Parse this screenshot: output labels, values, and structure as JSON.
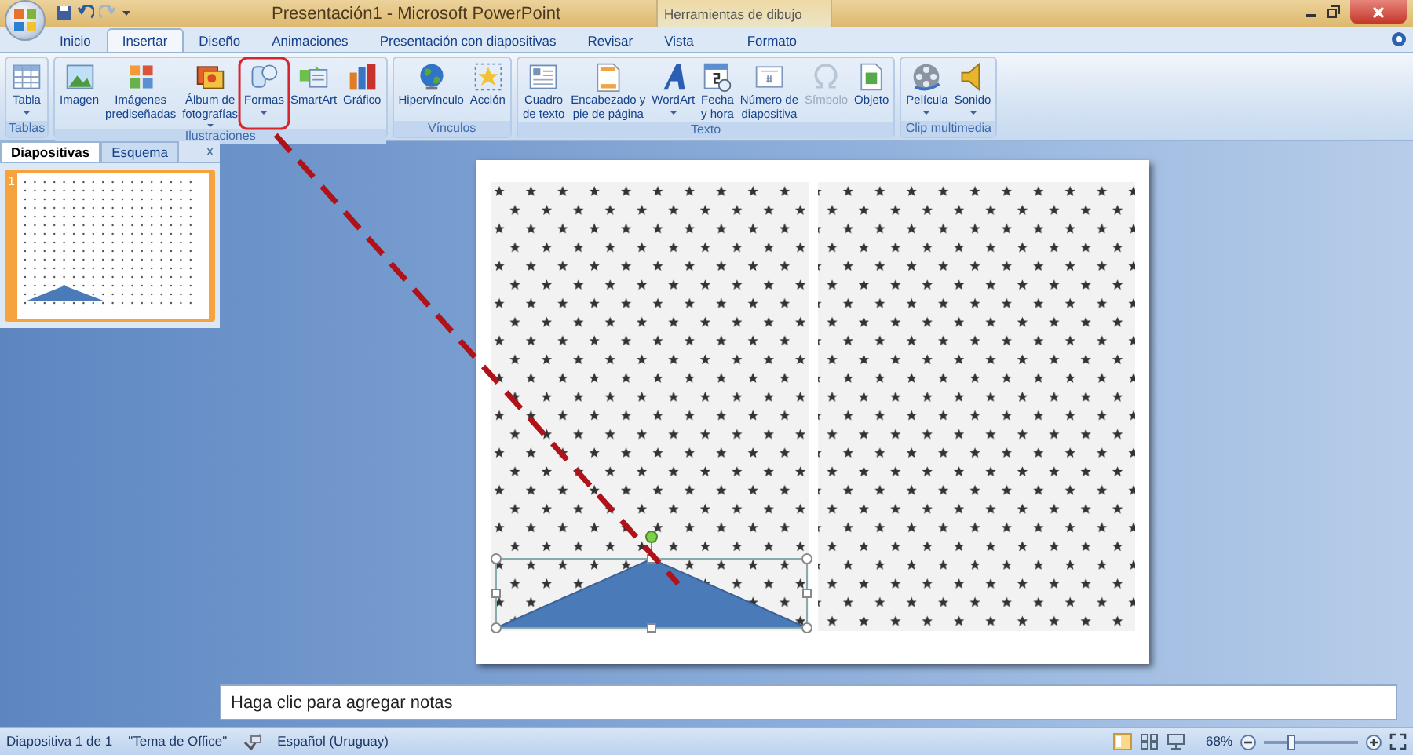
{
  "window": {
    "title": "Presentación1 - Microsoft PowerPoint",
    "contextual_tab_group": "Herramientas de dibujo"
  },
  "tabs": [
    {
      "label": "Inicio",
      "selected": false
    },
    {
      "label": "Insertar",
      "selected": true
    },
    {
      "label": "Diseño",
      "selected": false
    },
    {
      "label": "Animaciones",
      "selected": false
    },
    {
      "label": "Presentación con diapositivas",
      "selected": false
    },
    {
      "label": "Revisar",
      "selected": false
    },
    {
      "label": "Vista",
      "selected": false
    },
    {
      "label": "Formato",
      "selected": false
    }
  ],
  "ribbon_groups": [
    {
      "label": "Tablas",
      "buttons": [
        {
          "label": "Tabla",
          "dropdown": true,
          "disabled": false,
          "highlighted": false
        }
      ]
    },
    {
      "label": "Ilustraciones",
      "buttons": [
        {
          "label": "Imagen",
          "dropdown": false,
          "disabled": false,
          "highlighted": false
        },
        {
          "label": "Imágenes\nprediseñadas",
          "dropdown": false,
          "disabled": false,
          "highlighted": false
        },
        {
          "label": "Álbum de\nfotografías",
          "dropdown": true,
          "disabled": false,
          "highlighted": false
        },
        {
          "label": "Formas",
          "dropdown": true,
          "disabled": false,
          "highlighted": true
        },
        {
          "label": "SmartArt",
          "dropdown": false,
          "disabled": false,
          "highlighted": false
        },
        {
          "label": "Gráfico",
          "dropdown": false,
          "disabled": false,
          "highlighted": false
        }
      ]
    },
    {
      "label": "Vínculos",
      "buttons": [
        {
          "label": "Hipervínculo",
          "dropdown": false,
          "disabled": false,
          "highlighted": false
        },
        {
          "label": "Acción",
          "dropdown": false,
          "disabled": false,
          "highlighted": false
        }
      ]
    },
    {
      "label": "Texto",
      "buttons": [
        {
          "label": "Cuadro\nde texto",
          "dropdown": false,
          "disabled": false,
          "highlighted": false
        },
        {
          "label": "Encabezado y\npie de página",
          "dropdown": false,
          "disabled": false,
          "highlighted": false
        },
        {
          "label": "WordArt",
          "dropdown": true,
          "disabled": false,
          "highlighted": false
        },
        {
          "label": "Fecha\ny hora",
          "dropdown": false,
          "disabled": false,
          "highlighted": false
        },
        {
          "label": "Número de\ndiapositiva",
          "dropdown": false,
          "disabled": false,
          "highlighted": false
        },
        {
          "label": "Símbolo",
          "dropdown": false,
          "disabled": true,
          "highlighted": false
        },
        {
          "label": "Objeto",
          "dropdown": false,
          "disabled": false,
          "highlighted": false
        }
      ]
    },
    {
      "label": "Clip multimedia",
      "buttons": [
        {
          "label": "Película",
          "dropdown": true,
          "disabled": false,
          "highlighted": false
        },
        {
          "label": "Sonido",
          "dropdown": true,
          "disabled": false,
          "highlighted": false
        }
      ]
    }
  ],
  "pane": {
    "tabs": [
      {
        "label": "Diapositivas",
        "selected": true
      },
      {
        "label": "Esquema",
        "selected": false
      }
    ],
    "close": "x",
    "slides": [
      {
        "number": "1",
        "selected": true
      }
    ]
  },
  "notes": {
    "placeholder": "Haga clic para agregar notas"
  },
  "status_bar": {
    "slide": "Diapositiva 1 de 1",
    "theme": "\"Tema de Office\"",
    "language": "Español (Uruguay)",
    "zoom": "68%",
    "zoom_slider": {
      "level": 0.3
    }
  }
}
